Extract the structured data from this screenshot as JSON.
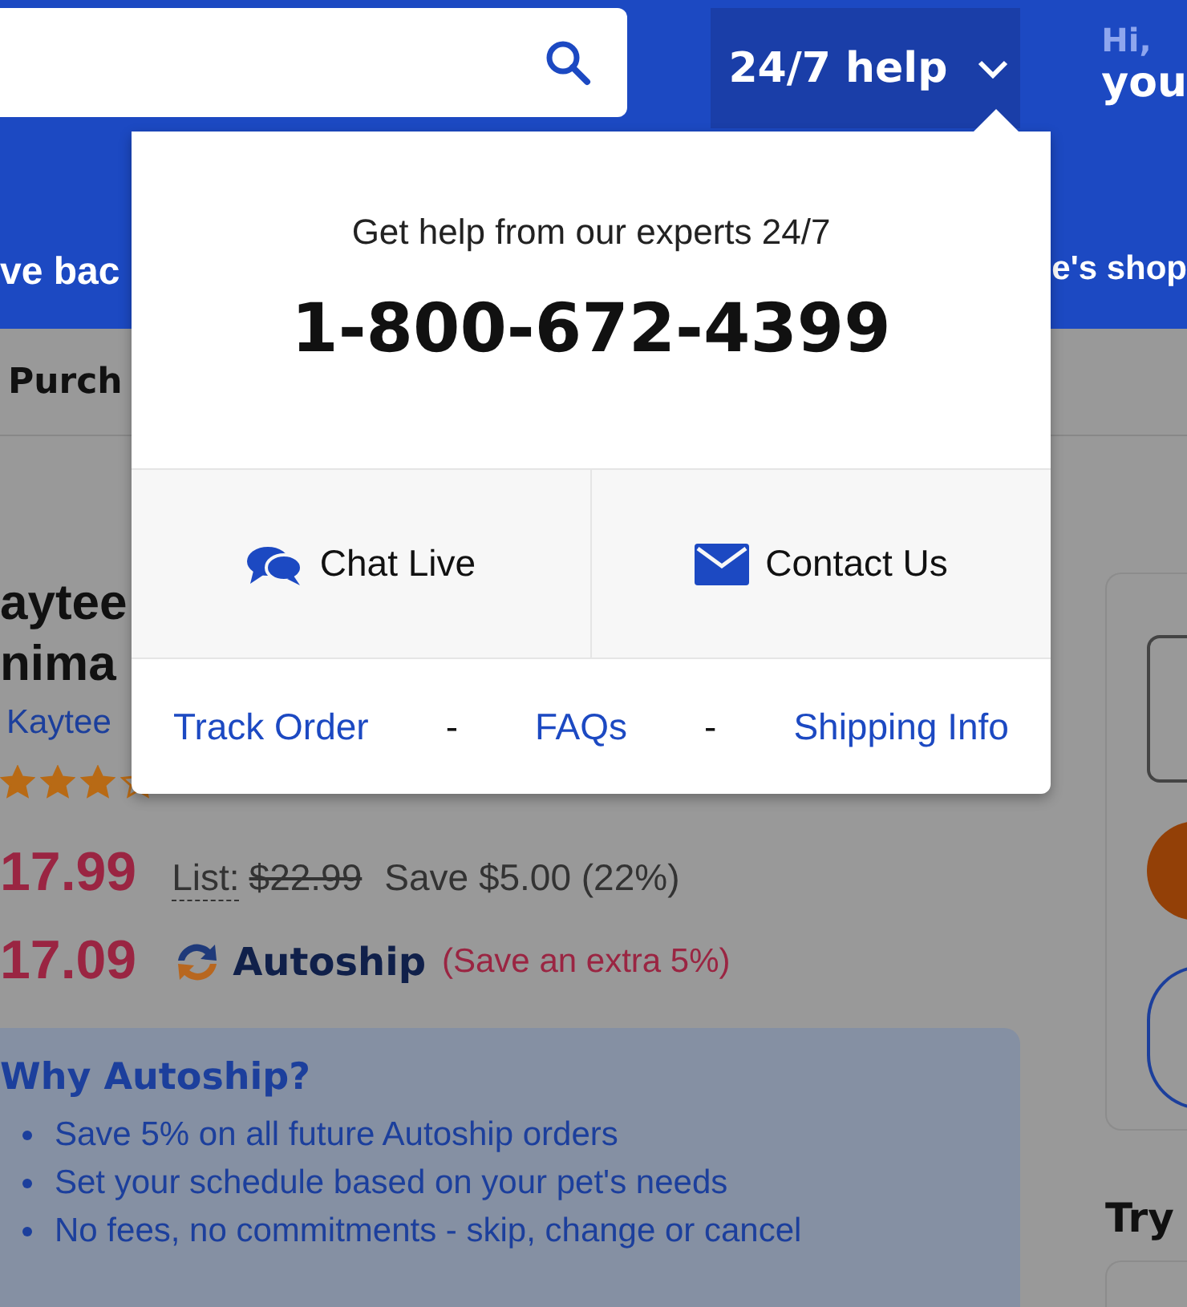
{
  "help_button": {
    "label": "24/7 help",
    "expanded": true
  },
  "account": {
    "greeting": "Hi,",
    "name": "you"
  },
  "banner": {
    "left_text": "ve bac",
    "right_text": "e's shop"
  },
  "nav": {
    "items": [
      {
        "label": "Purch"
      }
    ]
  },
  "product": {
    "title_lines": [
      "aytee",
      "nima"
    ],
    "brand": "Kaytee",
    "stars": 3,
    "price": "17.99",
    "list_label": "List:",
    "list_price": "$22.99",
    "savings": "Save $5.00 (22%)",
    "autoship_price": "17.09",
    "autoship_label": "Autoship",
    "autoship_savings": "(Save an extra 5%)"
  },
  "why_autoship": {
    "title": "Why Autoship?",
    "bullets": [
      "Save 5% on all future Autoship orders",
      "Set your schedule based on your pet's needs",
      "No fees, no commitments - skip, change or cancel"
    ]
  },
  "side": {
    "heading": "Try"
  },
  "help_popup": {
    "intro": "Get help from our experts 24/7",
    "phone": "1-800-672-4399",
    "actions": [
      {
        "label": "Chat Live",
        "kind": "chat"
      },
      {
        "label": "Contact Us",
        "kind": "email"
      }
    ],
    "links": [
      "Track Order",
      "FAQs",
      "Shipping Info"
    ],
    "separators": [
      "-",
      "-"
    ]
  }
}
